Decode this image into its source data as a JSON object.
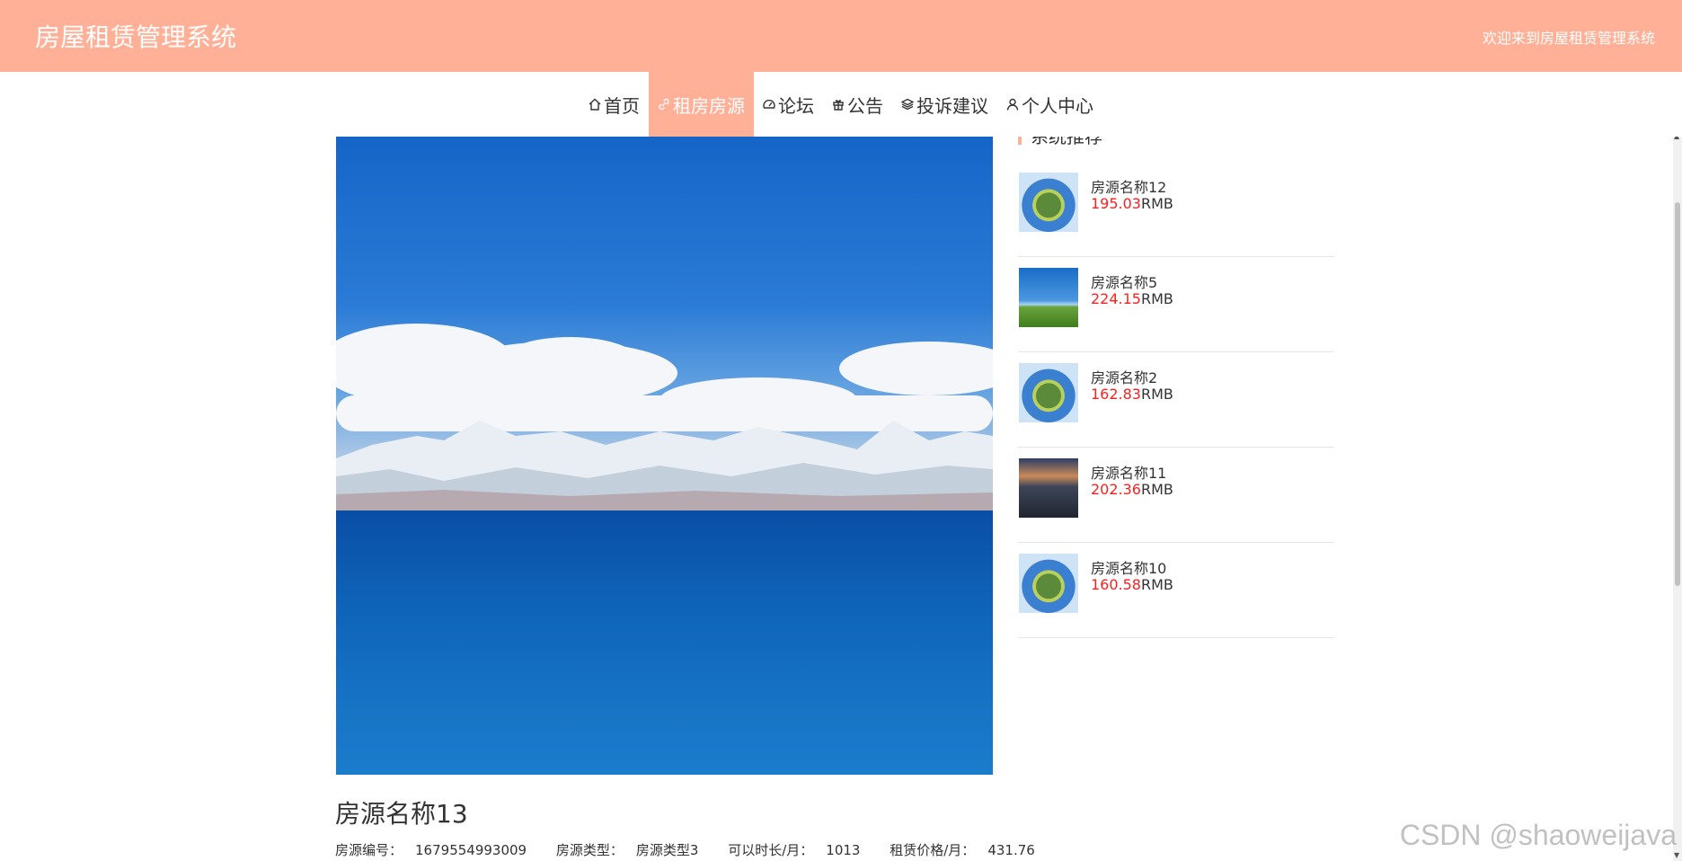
{
  "header": {
    "title": "房屋租赁管理系统",
    "welcome": "欢迎来到房屋租赁管理系统"
  },
  "nav": [
    {
      "label": "首页",
      "icon": "home-icon",
      "active": false
    },
    {
      "label": "租房房源",
      "icon": "link-icon",
      "active": true
    },
    {
      "label": "论坛",
      "icon": "gauge-icon",
      "active": false
    },
    {
      "label": "公告",
      "icon": "gift-icon",
      "active": false
    },
    {
      "label": "投诉建议",
      "icon": "layers-icon",
      "active": false
    },
    {
      "label": "个人中心",
      "icon": "user-icon",
      "active": false
    }
  ],
  "detail": {
    "name": "房源名称13",
    "meta": {
      "code_label": "房源编号：",
      "code": "1679554993009",
      "type_label": "房源类型：",
      "type": "房源类型3",
      "term_label": "可以时长/月：",
      "term": "1013",
      "price_label": "租赁价格/月：",
      "price": "431.76"
    }
  },
  "sidebar": {
    "heading": "系统推荐",
    "currency": "RMB",
    "items": [
      {
        "name": "房源名称12",
        "price": "195.03",
        "thumb": "globe"
      },
      {
        "name": "房源名称5",
        "price": "224.15",
        "thumb": "field"
      },
      {
        "name": "房源名称2",
        "price": "162.83",
        "thumb": "globe"
      },
      {
        "name": "房源名称11",
        "price": "202.36",
        "thumb": "city"
      },
      {
        "name": "房源名称10",
        "price": "160.58",
        "thumb": "globe"
      }
    ]
  },
  "watermark": "CSDN @shaoweijava",
  "colors": {
    "accent": "#ffb097",
    "price": "#ff1e1e"
  }
}
